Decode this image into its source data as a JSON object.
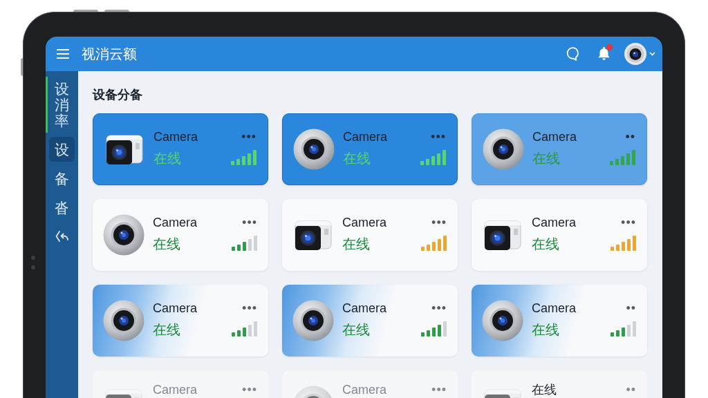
{
  "header": {
    "title": "视消云额",
    "unread_notifications": true
  },
  "sidebar": {
    "items": [
      {
        "kind": "text",
        "label": "设消率",
        "selected": true,
        "highlighted": false
      },
      {
        "kind": "text",
        "label": "设",
        "selected": false,
        "highlighted": true
      },
      {
        "kind": "text",
        "label": "备",
        "selected": false,
        "highlighted": false
      },
      {
        "kind": "text",
        "label": "沓",
        "selected": false,
        "highlighted": false
      },
      {
        "kind": "icon",
        "selected": false,
        "highlighted": false
      }
    ]
  },
  "main": {
    "title": "设备分备",
    "devices": [
      {
        "kind": "filled",
        "camera": {
          "kind": "box"
        },
        "name": "Camera",
        "dimmed": false,
        "menu": "•••",
        "status": "在线",
        "signal": {
          "kind": "full",
          "color": "#5ad66f"
        }
      },
      {
        "kind": "filled",
        "camera": {
          "kind": "dome"
        },
        "name": "Camera",
        "dimmed": false,
        "menu": "•••",
        "status": "在线",
        "signal": {
          "kind": "full",
          "color": "#5ad66f"
        }
      },
      {
        "kind": "tinted",
        "camera": {
          "kind": "dome"
        },
        "name": "Camera",
        "dimmed": false,
        "menu": "••",
        "status": "在线",
        "signal": {
          "kind": "full",
          "color": "#2fa84c"
        }
      },
      {
        "kind": "plain",
        "camera": {
          "kind": "dome"
        },
        "name": "Camera",
        "dimmed": false,
        "menu": "•••",
        "status": "在线",
        "signal": {
          "kind": "fair",
          "color": "#2e9e48"
        }
      },
      {
        "kind": "plain",
        "camera": {
          "kind": "box"
        },
        "name": "Camera",
        "dimmed": false,
        "menu": "•••",
        "status": "在线",
        "signal": {
          "kind": "full",
          "color": "#f0a532"
        }
      },
      {
        "kind": "plain",
        "camera": {
          "kind": "box"
        },
        "name": "Camera",
        "dimmed": false,
        "menu": "•••",
        "status": "在线",
        "signal": {
          "kind": "full",
          "color": "#f0a532"
        }
      },
      {
        "kind": "gradient",
        "camera": {
          "kind": "dome"
        },
        "name": "Camera",
        "dimmed": false,
        "menu": "•••",
        "status": "在线",
        "signal": {
          "kind": "fair",
          "color": "#2e9e48"
        }
      },
      {
        "kind": "gradient",
        "camera": {
          "kind": "dome"
        },
        "name": "Camera",
        "dimmed": false,
        "menu": "•••",
        "status": "在线",
        "signal": {
          "kind": "good",
          "color": "#2e9e48"
        }
      },
      {
        "kind": "gradient",
        "camera": {
          "kind": "dome"
        },
        "name": "Camera",
        "dimmed": false,
        "menu": "••",
        "status": "在线",
        "signal": {
          "kind": "fair",
          "color": "#2e9e48"
        }
      },
      {
        "kind": "faded",
        "camera": {
          "kind": "box"
        },
        "name": "Camera",
        "dimmed": true,
        "menu": "•••"
      },
      {
        "kind": "faded",
        "camera": {
          "kind": "dome"
        },
        "name": "Camera",
        "dimmed": true,
        "menu": "•••"
      },
      {
        "kind": "faded",
        "camera": {
          "kind": "box"
        },
        "name": "在线",
        "dimmed": false,
        "menu": "••"
      }
    ]
  }
}
